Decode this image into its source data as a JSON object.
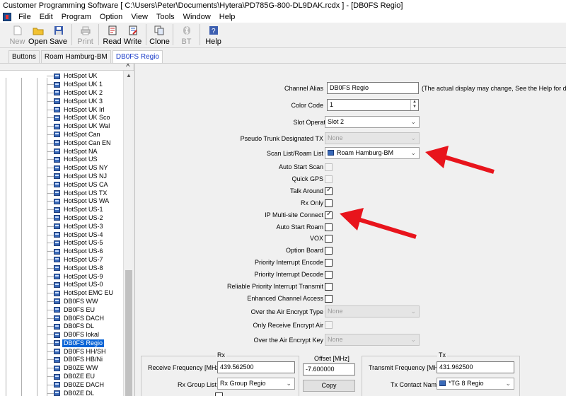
{
  "title_bar": {
    "title": "Customer Programming Software [ C:\\Users\\Peter\\Documents\\Hytera\\PD785G-800-DL9DAK.rcdx ] - [DB0FS Regio]"
  },
  "menu": {
    "items": [
      "File",
      "Edit",
      "Program",
      "Option",
      "View",
      "Tools",
      "Window",
      "Help"
    ]
  },
  "toolbar": {
    "new": "New",
    "open": "Open",
    "save": "Save",
    "print": "Print",
    "read": "Read",
    "write": "Write",
    "clone": "Clone",
    "bt": "BT",
    "help": "Help"
  },
  "tabs": [
    {
      "label": "Buttons"
    },
    {
      "label": "Roam Hamburg-BM"
    },
    {
      "label": "DB0FS Regio"
    }
  ],
  "tree": {
    "items": [
      "HotSpot UK",
      "HotSpot UK 1",
      "HotSpot UK 2",
      "HotSpot UK 3",
      "HotSpot UK Irl",
      "HotSpot UK Sco",
      "HotSpot UK Wal",
      "HotSpot Can",
      "HotSpot Can EN",
      "HotSpot NA",
      "HotSpot US",
      "HotSpot US NY",
      "HotSpot US NJ",
      "HotSpot US CA",
      "HotSpot US TX",
      "HotSpot US WA",
      "HotSpot US-1",
      "HotSpot US-2",
      "HotSpot US-3",
      "HotSpot US-4",
      "HotSpot US-5",
      "HotSpot US-6",
      "HotSpot US-7",
      "HotSpot US-8",
      "HotSpot US-9",
      "HotSpot US-0",
      "HotSpot EMC EU",
      "DB0FS WW",
      "DB0FS EU",
      "DB0FS DACH",
      "DB0FS DL",
      "DB0FS lokal",
      "DB0FS Regio",
      "DB0FS HH/SH",
      "DB0FS HB/Ni",
      "DB0ZE WW",
      "DB0ZE EU",
      "DB0ZE DACH",
      "DB0ZE DL"
    ],
    "selected": "DB0FS Regio"
  },
  "form": {
    "channel_alias": {
      "label": "Channel Alias",
      "value": "DB0FS Regio",
      "note": "(The actual display may change, See the Help for details)"
    },
    "color_code": {
      "label": "Color Code",
      "value": "1"
    },
    "slot_operation": {
      "label": "Slot Operation",
      "value": "Slot 2"
    },
    "pseudo_trunk": {
      "label": "Pseudo Trunk Designated TX",
      "value": "None"
    },
    "scan_list": {
      "label": "Scan List/Roam List",
      "value": "Roam Hamburg-BM"
    },
    "auto_start_scan": {
      "label": "Auto Start Scan",
      "checked": false,
      "enabled": false
    },
    "quick_gps": {
      "label": "Quick GPS",
      "checked": false,
      "enabled": false
    },
    "talk_around": {
      "label": "Talk Around",
      "checked": true,
      "enabled": true
    },
    "rx_only": {
      "label": "Rx Only",
      "checked": false,
      "enabled": true
    },
    "ip_multisite": {
      "label": "IP Multi-site Connect",
      "checked": true,
      "enabled": true
    },
    "auto_start_roam": {
      "label": "Auto Start Roam",
      "checked": false,
      "enabled": true
    },
    "vox": {
      "label": "VOX",
      "checked": false,
      "enabled": true
    },
    "option_board": {
      "label": "Option Board",
      "checked": false,
      "enabled": true
    },
    "priority_encode": {
      "label": "Priority Interrupt Encode",
      "checked": false,
      "enabled": true
    },
    "priority_decode": {
      "label": "Priority Interrupt Decode",
      "checked": false,
      "enabled": true
    },
    "reliable_priority": {
      "label": "Reliable Priority Interrupt Transmit",
      "checked": false,
      "enabled": true
    },
    "enhanced_access": {
      "label": "Enhanced Channel Access",
      "checked": false,
      "enabled": true
    },
    "encrypt_type": {
      "label": "Over the Air Encrypt Type",
      "value": "None"
    },
    "only_receive_encrypt": {
      "label": "Only Receive Encrypt Air",
      "checked": false,
      "enabled": false
    },
    "encrypt_key": {
      "label": "Over the Air Encrypt Key",
      "value": "None"
    }
  },
  "rx": {
    "title": "Rx",
    "freq_label": "Receive Frequency [MHz]",
    "freq_value": "439.562500",
    "group_label": "Rx Group List",
    "group_value": "Rx Group Regio"
  },
  "offset": {
    "title": "Offset [MHz]",
    "value": "-7.600000",
    "copy": "Copy"
  },
  "tx": {
    "title": "Tx",
    "freq_label": "Transmit Frequency [MHz]",
    "freq_value": "431.962500",
    "contact_label": "Tx Contact Name",
    "contact_value": "*TG 8 Regio"
  },
  "colors": {
    "accent_selection": "#0a64d6",
    "annotation_arrow": "#e8141c",
    "active_tab_text": "#1a3cc8"
  }
}
